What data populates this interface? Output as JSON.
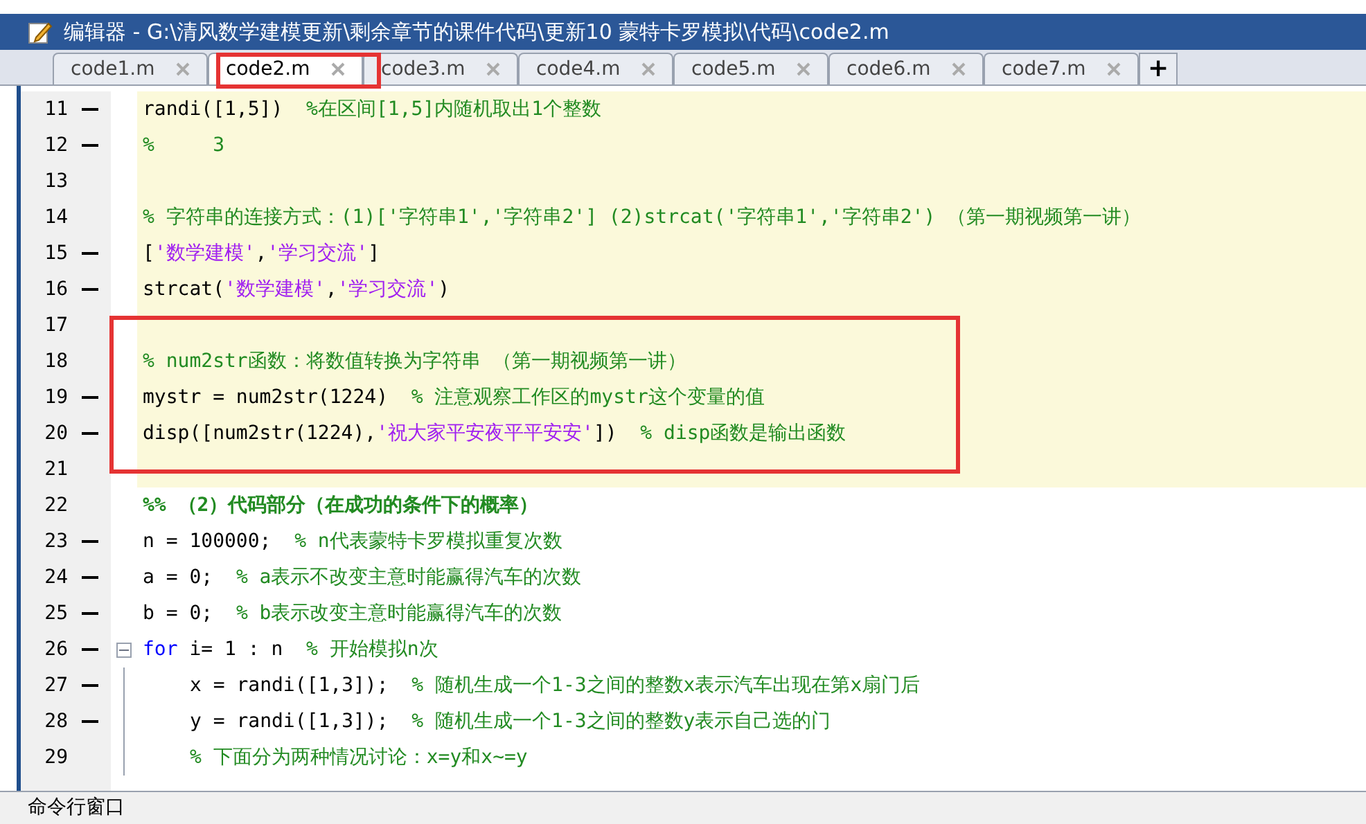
{
  "window": {
    "title": "编辑器 - G:\\清风数学建模更新\\剩余章节的课件代码\\更新10 蒙特卡罗模拟\\代码\\code2.m"
  },
  "tabs": [
    {
      "label": "code1.m",
      "selected": false
    },
    {
      "label": "code2.m",
      "selected": true
    },
    {
      "label": "code3.m",
      "selected": false
    },
    {
      "label": "code4.m",
      "selected": false
    },
    {
      "label": "code5.m",
      "selected": false
    },
    {
      "label": "code6.m",
      "selected": false
    },
    {
      "label": "code7.m",
      "selected": false
    }
  ],
  "new_tab": "+",
  "lines": [
    {
      "number": "11",
      "executable": true,
      "cell": true,
      "segments": [
        {
          "kind": "code",
          "text": "randi([1,5])  "
        },
        {
          "kind": "comment",
          "text": "%在区间[1,5]内随机取出1个整数"
        }
      ]
    },
    {
      "number": "12",
      "executable": true,
      "cell": true,
      "segments": [
        {
          "kind": "comment",
          "text": "%     3"
        }
      ]
    },
    {
      "number": "13",
      "executable": false,
      "cell": true
    },
    {
      "number": "14",
      "executable": false,
      "cell": true,
      "segments": [
        {
          "kind": "comment",
          "text": "% 字符串的连接方式：(1)['字符串1','字符串2'] (2)strcat('字符串1','字符串2') （第一期视频第一讲）"
        }
      ]
    },
    {
      "number": "15",
      "executable": true,
      "cell": true,
      "segments": [
        {
          "kind": "code",
          "text": "["
        },
        {
          "kind": "string",
          "text": "'数学建模'"
        },
        {
          "kind": "code",
          "text": ","
        },
        {
          "kind": "string",
          "text": "'学习交流'"
        },
        {
          "kind": "code",
          "text": "]"
        }
      ]
    },
    {
      "number": "16",
      "executable": true,
      "cell": true,
      "segments": [
        {
          "kind": "code",
          "text": "strcat("
        },
        {
          "kind": "string",
          "text": "'数学建模'"
        },
        {
          "kind": "code",
          "text": ","
        },
        {
          "kind": "string",
          "text": "'学习交流'"
        },
        {
          "kind": "code",
          "text": ")"
        }
      ]
    },
    {
      "number": "17",
      "executable": false,
      "cell": true
    },
    {
      "number": "18",
      "executable": false,
      "cell": true,
      "segments": [
        {
          "kind": "comment",
          "text": "% num2str函数：将数值转换为字符串 （第一期视频第一讲）"
        }
      ]
    },
    {
      "number": "19",
      "executable": true,
      "cell": true,
      "segments": [
        {
          "kind": "code",
          "text": "mystr = num2str(1224)  "
        },
        {
          "kind": "comment",
          "text": "% 注意观察工作区的mystr这个变量的值"
        }
      ]
    },
    {
      "number": "20",
      "executable": true,
      "cell": true,
      "segments": [
        {
          "kind": "code",
          "text": "disp([num2str(1224),"
        },
        {
          "kind": "string",
          "text": "'祝大家平安夜平平安安'"
        },
        {
          "kind": "code",
          "text": "])  "
        },
        {
          "kind": "comment",
          "text": "% disp函数是输出函数"
        }
      ]
    },
    {
      "number": "21",
      "executable": false,
      "cell": true
    },
    {
      "number": "22",
      "executable": false,
      "cell": false,
      "segments": [
        {
          "kind": "section",
          "text": "%% （2）代码部分（在成功的条件下的概率）"
        }
      ]
    },
    {
      "number": "23",
      "executable": true,
      "cell": false,
      "segments": [
        {
          "kind": "code",
          "text": "n = 100000;  "
        },
        {
          "kind": "comment",
          "text": "% n代表蒙特卡罗模拟重复次数"
        }
      ]
    },
    {
      "number": "24",
      "executable": true,
      "cell": false,
      "segments": [
        {
          "kind": "code",
          "text": "a = 0;  "
        },
        {
          "kind": "comment",
          "text": "% a表示不改变主意时能赢得汽车的次数"
        }
      ]
    },
    {
      "number": "25",
      "executable": true,
      "cell": false,
      "segments": [
        {
          "kind": "code",
          "text": "b = 0;  "
        },
        {
          "kind": "comment",
          "text": "% b表示改变主意时能赢得汽车的次数"
        }
      ]
    },
    {
      "number": "26",
      "executable": true,
      "cell": false,
      "expanded": true,
      "segments": [
        {
          "kind": "keyword",
          "text": "for"
        },
        {
          "kind": "code",
          "text": " i= 1 : n  "
        },
        {
          "kind": "comment",
          "text": "% 开始模拟n次"
        }
      ],
      "children": [
        {
          "number": "27",
          "executable": true,
          "cell": false,
          "segments": [
            {
              "kind": "code",
              "text": "x = randi([1,3]);  "
            },
            {
              "kind": "comment",
              "text": "% 随机生成一个1-3之间的整数x表示汽车出现在第x扇门后"
            }
          ]
        },
        {
          "number": "28",
          "executable": true,
          "cell": false,
          "segments": [
            {
              "kind": "code",
              "text": "y = randi([1,3]);  "
            },
            {
              "kind": "comment",
              "text": "% 随机生成一个1-3之间的整数y表示自己选的门"
            }
          ]
        },
        {
          "number": "29",
          "executable": false,
          "cell": false,
          "segments": [
            {
              "kind": "comment",
              "text": "% 下面分为两种情况讨论：x=y和x~=y"
            }
          ]
        }
      ]
    }
  ],
  "command_window": {
    "title": "命令行窗口"
  }
}
